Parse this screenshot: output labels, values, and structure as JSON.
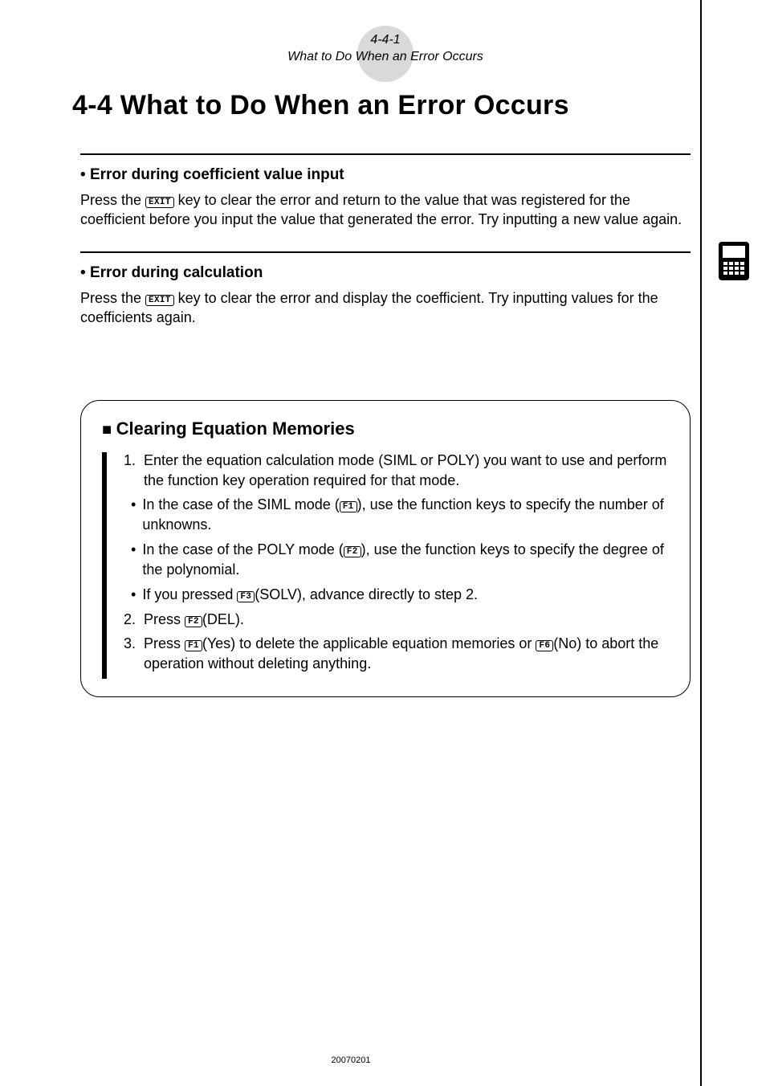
{
  "header": {
    "page_num": "4-4-1",
    "subtitle": "What to Do When an Error Occurs"
  },
  "title": "4-4  What to Do When an Error Occurs",
  "sections": [
    {
      "heading": "Error during coefficient value input",
      "body_pre": "Press the ",
      "key": "EXIT",
      "body_post": " key to clear the error and return to the value that was registered for the coefficient before you input the value that generated the error. Try inputting a new value again."
    },
    {
      "heading": "Error during calculation",
      "body_pre": "Press the ",
      "key": "EXIT",
      "body_post": " key to clear the error and display the coefficient. Try inputting values for the coefficients again."
    }
  ],
  "box": {
    "title": "Clearing Equation Memories",
    "step1": {
      "num": "1.",
      "text": "Enter the equation calculation mode (SIML or POLY) you want to use and perform the function key operation required for that mode."
    },
    "sub1": {
      "pre": "In the case of the SIML mode (",
      "key": "F1",
      "post": "), use the function keys to specify the number of unknowns."
    },
    "sub2": {
      "pre": "In the case of the POLY mode (",
      "key": "F2",
      "post": "), use the function keys to specify the degree of the polynomial."
    },
    "sub3": {
      "pre": "If you pressed ",
      "key": "F3",
      "post": "(SOLV), advance directly to step 2."
    },
    "step2": {
      "num": "2.",
      "pre": "Press ",
      "key": "F2",
      "post": "(DEL)."
    },
    "step3": {
      "num": "3.",
      "pre": "Press ",
      "key1": "F1",
      "mid": "(Yes) to delete the applicable equation memories or ",
      "key2": "F6",
      "post": "(No) to abort the operation without deleting anything."
    }
  },
  "footer": "20070201",
  "icon_name": "calculator-icon"
}
